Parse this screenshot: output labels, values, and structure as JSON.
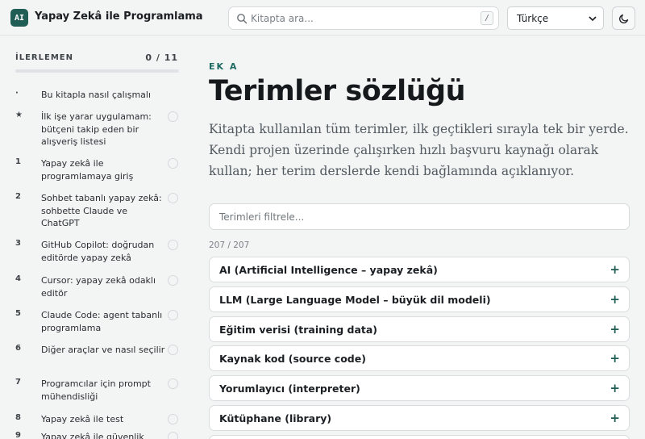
{
  "app": {
    "logo_text": "AI",
    "title": "Yapay Zekâ ile Programlama"
  },
  "search": {
    "placeholder": "Kitapta ara...",
    "shortcut": "/"
  },
  "language": {
    "selected": "Türkçe"
  },
  "sidebar": {
    "progress_label": "İLERLEMEN",
    "progress_count": "0 / 11",
    "progress_fraction": 0,
    "items": [
      {
        "num": "·",
        "label": "Bu kitapla nasıl çalışmalı",
        "has_check": false
      },
      {
        "num": "★",
        "label": "İlk işe yarar uygulamam: bütçeni takip eden bir alışveriş listesi",
        "has_check": true
      },
      {
        "num": "1",
        "label": "Yapay zekâ ile programlamaya giriş",
        "has_check": true
      },
      {
        "num": "2",
        "label": "Sohbet tabanlı yapay zekâ: sohbette Claude ve ChatGPT",
        "has_check": true
      },
      {
        "num": "3",
        "label": "GitHub Copilot: doğrudan editörde yapay zekâ",
        "has_check": true
      },
      {
        "num": "4",
        "label": "Cursor: yapay zekâ odaklı editör",
        "has_check": true
      },
      {
        "num": "5",
        "label": "Claude Code: agent tabanlı programlama",
        "has_check": true
      },
      {
        "num": "6",
        "label": "Diğer araçlar ve nasıl seçilir",
        "has_check": true
      },
      {
        "num": "7",
        "label": "Programcılar için prompt mühendisliği",
        "has_check": true
      },
      {
        "num": "8",
        "label": "Yapay zekâ ile test",
        "has_check": true
      },
      {
        "num": "9",
        "label": "Yapay zekâ ile güvenlik",
        "has_check": true
      }
    ]
  },
  "main": {
    "eyebrow": "EK A",
    "title": "Terimler sözlüğü",
    "lead": "Kitapta kullanılan tüm terimler, ilk geçtikleri sırayla tek bir yerde. Kendi projen üzerinde çalışırken hızlı başvuru kaynağı olarak kullan; her terim derslerde kendi bağlamında açıklanıyor.",
    "filter_placeholder": "Terimleri filtrele...",
    "count": "207 / 207",
    "expand_symbol": "+",
    "terms": [
      "AI (Artificial Intelligence – yapay zekâ)",
      "LLM (Large Language Model – büyük dil modeli)",
      "Eğitim verisi (training data)",
      "Kaynak kod (source code)",
      "Yorumlayıcı (interpreter)",
      "Kütüphane (library)",
      ""
    ]
  },
  "colors": {
    "accent": "#1f5d55",
    "eyebrow": "#1f6b61",
    "background": "#f3f4f4"
  },
  "icons": {
    "search": "search-icon",
    "theme": "moon-icon",
    "language": "chevron-down-icon"
  }
}
